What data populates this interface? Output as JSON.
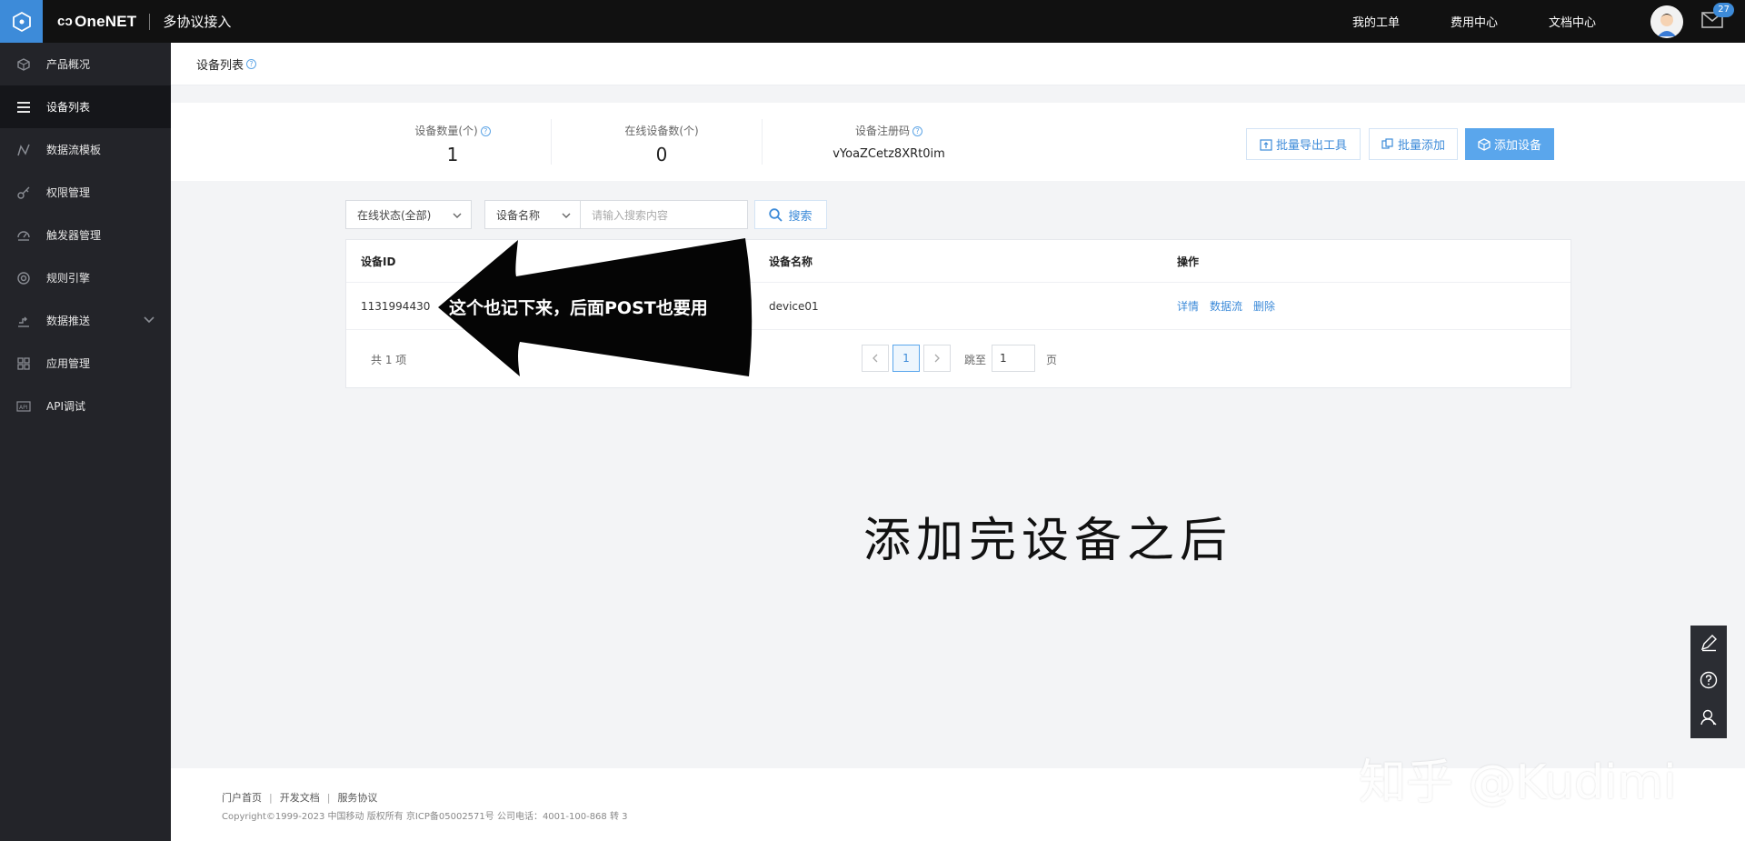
{
  "header": {
    "brand": "OneNET",
    "product": "多协议接入",
    "links": [
      "我的工单",
      "费用中心",
      "文档中心"
    ],
    "mail_count": "27"
  },
  "sidebar": {
    "items": [
      {
        "label": "产品概况",
        "icon": "cube-icon"
      },
      {
        "label": "设备列表",
        "icon": "list-icon"
      },
      {
        "label": "数据流模板",
        "icon": "stream-icon"
      },
      {
        "label": "权限管理",
        "icon": "key-icon"
      },
      {
        "label": "触发器管理",
        "icon": "trigger-icon"
      },
      {
        "label": "规则引擎",
        "icon": "rule-icon"
      },
      {
        "label": "数据推送",
        "icon": "push-icon"
      },
      {
        "label": "应用管理",
        "icon": "grid-icon"
      },
      {
        "label": "API调试",
        "icon": "api-icon"
      }
    ],
    "active_index": 1
  },
  "page": {
    "title": "设备列表"
  },
  "stats": {
    "device_count_label": "设备数量(个)",
    "device_count": "1",
    "online_label": "在线设备数(个)",
    "online_count": "0",
    "reg_code_label": "设备注册码",
    "reg_code": "vYoaZCetz8XRt0im"
  },
  "actions": {
    "export": "批量导出工具",
    "batch_add": "批量添加",
    "add_device": "添加设备"
  },
  "filters": {
    "status": "在线状态(全部)",
    "field": "设备名称",
    "search_placeholder": "请输入搜索内容",
    "search_button": "搜索"
  },
  "table": {
    "columns": [
      "设备ID",
      "设备名称",
      "操作"
    ],
    "rows": [
      {
        "id": "1131994430",
        "name": "device01",
        "ops": [
          "详情",
          "数据流",
          "删除"
        ]
      }
    ],
    "total": "共 1 项",
    "current_page": "1",
    "jump_label": "跳至",
    "jump_value": "1",
    "page_unit": "页"
  },
  "annotations": {
    "arrow_text": "这个也记下来，后面POST也要用",
    "note": "添加完设备之后",
    "watermark": "知乎 @Kudimi"
  },
  "footer": {
    "links": [
      "门户首页",
      "开发文档",
      "服务协议"
    ],
    "copyright": "Copyright©1999-2023 中国移动 版权所有 京ICP备05002571号 公司电话：4001-100-868 转 3"
  }
}
